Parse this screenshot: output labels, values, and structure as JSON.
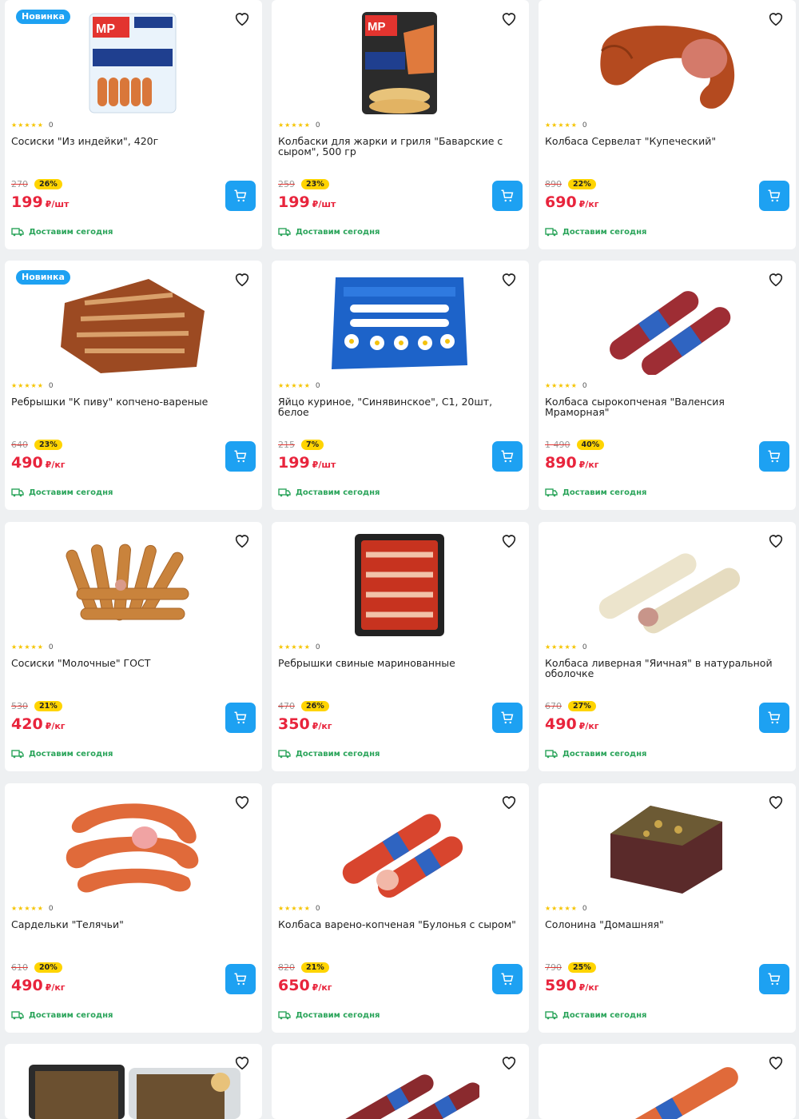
{
  "products": [
    {
      "badge": "Новинка",
      "title": "Сосиски \"Из индейки\", 420г",
      "rating_count": "0",
      "old_price": "270",
      "discount": "26%",
      "price": "199",
      "unit": "₽/шт",
      "delivery": "Доставим сегодня",
      "image": "turkey-sausages-package-image"
    },
    {
      "badge": "",
      "title": "Колбаски для жарки и гриля \"Баварские с сыром\", 500 гр",
      "rating_count": "0",
      "old_price": "259",
      "discount": "23%",
      "price": "199",
      "unit": "₽/шт",
      "delivery": "Доставим сегодня",
      "image": "bavarian-sausages-package-image"
    },
    {
      "badge": "",
      "title": "Колбаса Сервелат \"Купеческий\"",
      "rating_count": "0",
      "old_price": "890",
      "discount": "22%",
      "price": "690",
      "unit": "₽/кг",
      "delivery": "Доставим сегодня",
      "image": "cervelat-sausage-image"
    },
    {
      "badge": "Новинка",
      "title": "Ребрышки \"К пиву\" копчено-вареные",
      "rating_count": "0",
      "old_price": "640",
      "discount": "23%",
      "price": "490",
      "unit": "₽/кг",
      "delivery": "Доставим сегодня",
      "image": "smoked-ribs-image"
    },
    {
      "badge": "",
      "title": "Яйцо куриное, \"Синявинское\", С1, 20шт, белое",
      "rating_count": "0",
      "old_price": "215",
      "discount": "7%",
      "price": "199",
      "unit": "₽/шт",
      "delivery": "Доставим сегодня",
      "image": "egg-box-image"
    },
    {
      "badge": "",
      "title": "Колбаса сырокопченая \"Валенсия Мраморная\"",
      "rating_count": "0",
      "old_price": "1 490",
      "discount": "40%",
      "price": "890",
      "unit": "₽/кг",
      "delivery": "Доставим сегодня",
      "image": "valencia-sausage-image"
    },
    {
      "badge": "",
      "title": "Сосиски \"Молочные\" ГОСТ",
      "rating_count": "0",
      "old_price": "530",
      "discount": "21%",
      "price": "420",
      "unit": "₽/кг",
      "delivery": "Доставим сегодня",
      "image": "milk-sausages-image"
    },
    {
      "badge": "",
      "title": "Ребрышки свиные маринованные",
      "rating_count": "0",
      "old_price": "470",
      "discount": "26%",
      "price": "350",
      "unit": "₽/кг",
      "delivery": "Доставим сегодня",
      "image": "marinated-ribs-tray-image"
    },
    {
      "badge": "",
      "title": "Колбаса ливерная \"Яичная\" в натуральной оболочке",
      "rating_count": "0",
      "old_price": "670",
      "discount": "27%",
      "price": "490",
      "unit": "₽/кг",
      "delivery": "Доставим сегодня",
      "image": "liver-sausage-image"
    },
    {
      "badge": "",
      "title": "Сардельки \"Телячьи\"",
      "rating_count": "0",
      "old_price": "610",
      "discount": "20%",
      "price": "490",
      "unit": "₽/кг",
      "delivery": "Доставим сегодня",
      "image": "veal-wieners-image"
    },
    {
      "badge": "",
      "title": "Колбаса варено-копченая \"Булонья с сыром\"",
      "rating_count": "0",
      "old_price": "820",
      "discount": "21%",
      "price": "650",
      "unit": "₽/кг",
      "delivery": "Доставим сегодня",
      "image": "bologna-cheese-sausage-image"
    },
    {
      "badge": "",
      "title": "Солонина \"Домашняя\"",
      "rating_count": "0",
      "old_price": "790",
      "discount": "25%",
      "price": "590",
      "unit": "₽/кг",
      "delivery": "Доставим сегодня",
      "image": "corned-beef-image"
    },
    {
      "badge": "",
      "title": "",
      "rating_count": "",
      "old_price": "",
      "discount": "",
      "price": "",
      "unit": "",
      "delivery": "",
      "image": "jellied-meat-trays-image"
    },
    {
      "badge": "",
      "title": "",
      "rating_count": "",
      "old_price": "",
      "discount": "",
      "price": "",
      "unit": "",
      "delivery": "",
      "image": "dry-sausages-image"
    },
    {
      "badge": "",
      "title": "",
      "rating_count": "",
      "old_price": "",
      "discount": "",
      "price": "",
      "unit": "",
      "delivery": "",
      "image": "packaged-sausage-image"
    }
  ],
  "colors": {
    "accent": "#1da1f2",
    "price": "#e8243c",
    "discount_bg": "#ffd400",
    "delivery": "#2aa45a",
    "star": "#f5c400"
  }
}
